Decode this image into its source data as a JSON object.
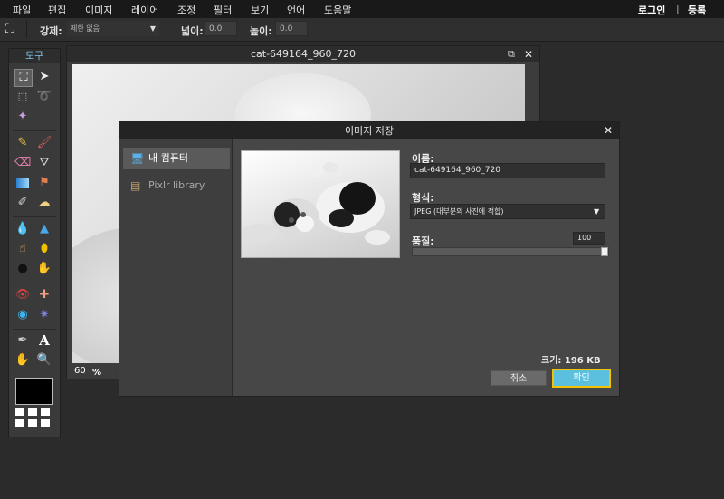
{
  "menu": {
    "items": [
      "파일",
      "편집",
      "이미지",
      "레이어",
      "조정",
      "필터",
      "보기",
      "언어",
      "도움말"
    ],
    "login": "로그인",
    "separator": "|",
    "register": "등록"
  },
  "options": {
    "constrain_label": "강제:",
    "constrain_value": "제한 없음",
    "width_label": "넓이:",
    "width_value": "0.0",
    "height_label": "높이:",
    "height_value": "0.0"
  },
  "tools": {
    "title": "도구"
  },
  "image_window": {
    "title": "cat-649164_960_720",
    "zoom_value": "60",
    "zoom_unit": "%"
  },
  "dialog": {
    "title": "이미지 저장",
    "sidebar": [
      {
        "label": "내 컴퓨터"
      },
      {
        "label": "Pixlr library"
      }
    ],
    "name_label": "이름:",
    "name_value": "cat-649164_960_720",
    "format_label": "형식:",
    "format_value": "JPEG (대부분의 사진에 적합)",
    "quality_label": "품질:",
    "quality_value": "100",
    "quality_fraction": 1.0,
    "size_text": "크기: 196 KB",
    "cancel_label": "취소",
    "ok_label": "확인"
  },
  "colors": {
    "accent": "#5bc0de",
    "highlight": "#f3c200",
    "tools_title": "#7fc3e6"
  }
}
